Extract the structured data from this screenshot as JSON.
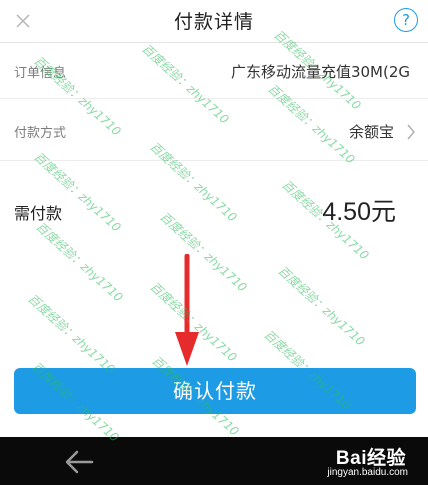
{
  "header": {
    "title": "付款详情",
    "help_label": "?"
  },
  "order": {
    "label": "订单信息",
    "value": "广东移动流量充值30M(2G"
  },
  "payment_method": {
    "label": "付款方式",
    "value": "余额宝"
  },
  "amount": {
    "label": "需付款",
    "value": "4.50元"
  },
  "confirm_button": {
    "label": "确认付款"
  },
  "watermark": {
    "text": "百度经验：zhy1710"
  },
  "footer_brand": {
    "name": "Bai经验",
    "url": "jingyan.baidu.com"
  },
  "colors": {
    "accent": "#1d9ce5",
    "arrow": "#e52b2b",
    "navbar": "#0a0a0a"
  },
  "icons": [
    "close-icon",
    "help-icon",
    "chevron-right-icon",
    "back-arrow-icon",
    "red-arrow-annotation"
  ]
}
